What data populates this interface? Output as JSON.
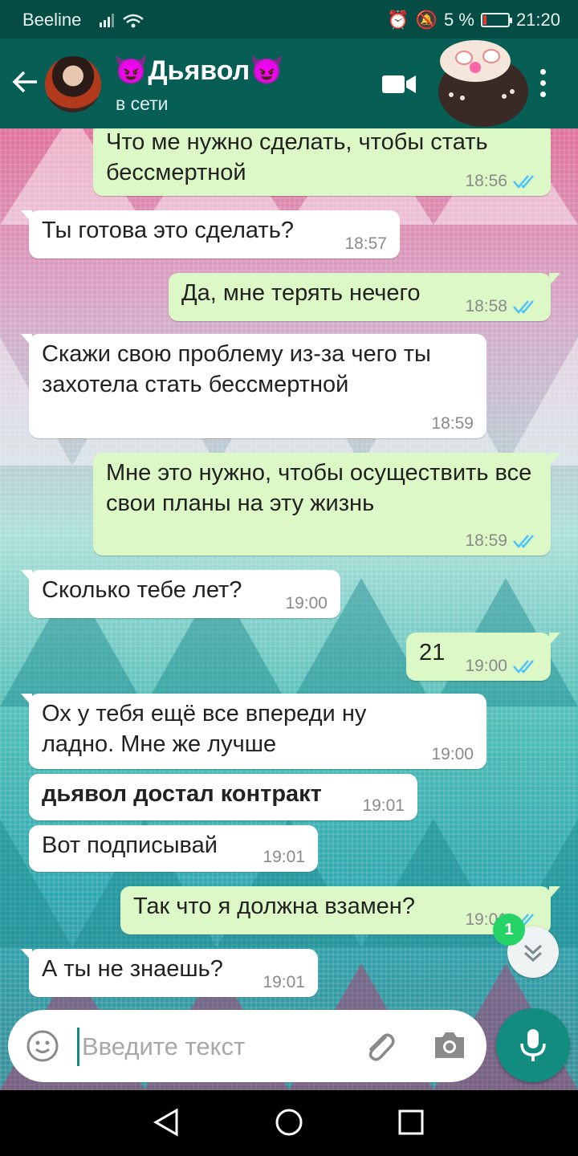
{
  "status_bar": {
    "carrier": "Beeline",
    "battery": "5 %",
    "time": "21:20"
  },
  "header": {
    "contact_name": "😈Дьявол😈",
    "contact_status": "в сети"
  },
  "messages": [
    {
      "side": "out",
      "text": "Что ме нужно сделать, чтобы стать бессмертной",
      "time": "18:56",
      "read": true
    },
    {
      "side": "in",
      "text": "Ты готова это сделать?",
      "time": "18:57"
    },
    {
      "side": "out",
      "text": "Да, мне терять нечего",
      "time": "18:58",
      "read": true
    },
    {
      "side": "in",
      "text": "Скажи свою проблему из-за чего ты захотела стать бессмертной",
      "time": "18:59"
    },
    {
      "side": "out",
      "text": "Мне это нужно, чтобы осуществить все свои планы на эту жизнь",
      "time": "18:59",
      "read": true
    },
    {
      "side": "in",
      "text": "Сколько тебе лет?",
      "time": "19:00"
    },
    {
      "side": "out",
      "text": "21",
      "time": "19:00",
      "read": true
    },
    {
      "side": "in",
      "text": "Ох у тебя ещё все  впереди ну ладно. Мне же лучше",
      "time": "19:00"
    },
    {
      "side": "in",
      "text": "дьявол достал контракт",
      "time": "19:01",
      "bold": true
    },
    {
      "side": "in",
      "text": "Вот подписывай",
      "time": "19:01"
    },
    {
      "side": "out",
      "text": "Так что я должна взамен?",
      "time": "19:01",
      "read": true
    },
    {
      "side": "in",
      "text": "А ты не знаешь?",
      "time": "19:01"
    }
  ],
  "unread_count": "1",
  "input": {
    "placeholder": "Введите текст"
  },
  "colors": {
    "header": "#075e54",
    "status_bar": "#054d44",
    "outgoing_bubble": "#dcf8c6",
    "incoming_bubble": "#ffffff",
    "accent": "#128c7e",
    "read_ticks": "#4fc3f7"
  }
}
